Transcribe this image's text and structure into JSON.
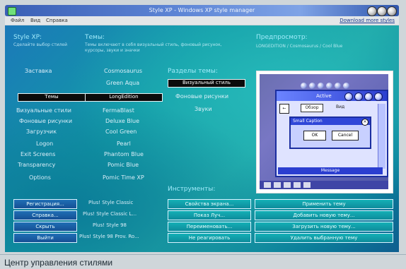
{
  "window": {
    "title": "Style XP - Windows XP style manager",
    "menu": [
      "Файл",
      "Вид",
      "Справка"
    ],
    "menu_link": "Download more styles"
  },
  "left_panel": {
    "heading": "Style XP:",
    "description": "Сделайте выбор стилей",
    "items": [
      "Заставка",
      "Темы",
      "Визуальные стили",
      "Фоновые рисунки",
      "Загрузчик",
      "Logon",
      "Exit Screens",
      "Transparency",
      "Options"
    ]
  },
  "themes_panel": {
    "heading": "Темы:",
    "description": "Темы включают в себя визуальный стиль, фоновый рисунок, курсоры, звуки и значки",
    "items": [
      "Cosmosaurus",
      "Green Aqua",
      "LongEdition",
      "FermaBlast",
      "Deluxe Blue",
      "Cool Green",
      "Pearl",
      "Phantom Blue",
      "Pomic Blue",
      "Pomic Time XP"
    ]
  },
  "sections": {
    "parts_heading": "Разделы темы:",
    "parts": [
      "Визуальный стиль",
      "Фоновые рисунки",
      "Звуки"
    ],
    "tools_heading": "Инструменты:"
  },
  "preview": {
    "heading": "Предпросмотр:",
    "caption": "LONGEDITION / Cosmosaurus / Cool Blue",
    "window_title": "Active",
    "toolbar_back": "←",
    "toolbar_tab1": "Обзор",
    "toolbar_tab2": "Вид",
    "dialog_title": "Small Caption",
    "dialog_ok": "OK",
    "dialog_cancel": "Cancel",
    "bottom_label": "Message"
  },
  "bottom_buttons": {
    "left": [
      "Регистрация...",
      "Справка...",
      "Скрыть",
      "Выйти"
    ],
    "themes": [
      "Plus! Style Classic",
      "Plus! Style Classic L...",
      "Plus! Style 98",
      "Plus! Style 98 Prov. Ro..."
    ],
    "tools": [
      "Свойства экрана...",
      "Показ Луч...",
      "Переименовать...",
      "Не реагировать"
    ],
    "right": [
      "Применить тему",
      "Добавить новую тему...",
      "Загрузить новую тему...",
      "Удалить выбранную тему"
    ]
  },
  "caption": "Центр управления стилями",
  "colors": {
    "accent": "#1fa6a6",
    "selected": "#0b0b0b",
    "title_bar": "#3a5fb5"
  }
}
